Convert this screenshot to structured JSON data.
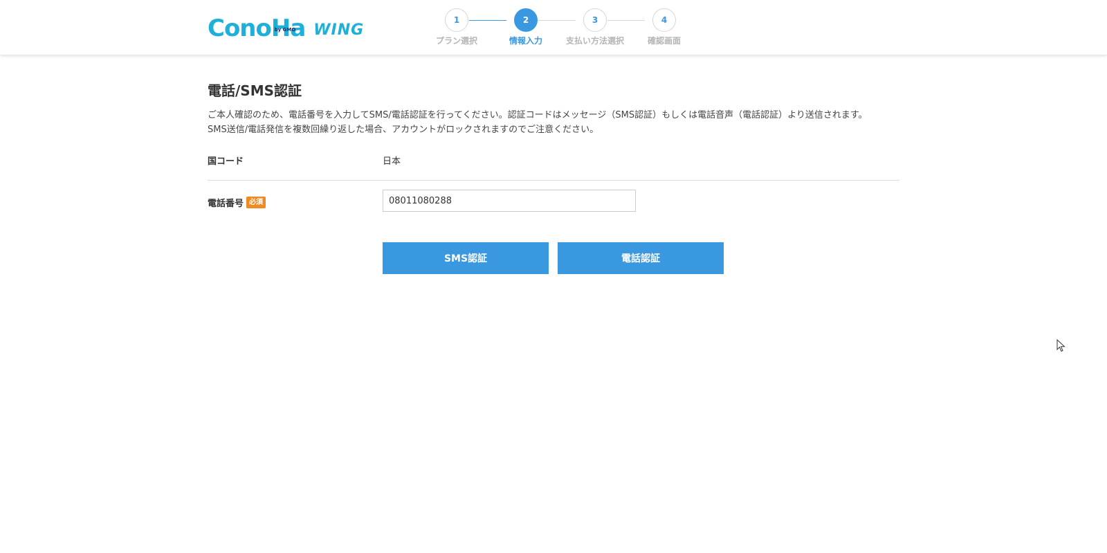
{
  "header": {
    "logo_text": "ConoHa",
    "logo_by": "by GMO",
    "logo_product": "WING",
    "steps": [
      {
        "number": "1",
        "label": "プラン選択",
        "active": false
      },
      {
        "number": "2",
        "label": "情報入力",
        "active": true
      },
      {
        "number": "3",
        "label": "支払い方法選択",
        "active": false
      },
      {
        "number": "4",
        "label": "確認画面",
        "active": false
      }
    ]
  },
  "main": {
    "title": "電話/SMS認証",
    "description_line1": "ご本人確認のため、電話番号を入力してSMS/電話認証を行ってください。認証コードはメッセージ（SMS認証）もしくは電話音声（電話認証）より送信されます。",
    "description_line2": "SMS送信/電話発信を複数回繰り返した場合、アカウントがロックされますのでご注意ください。",
    "country_label": "国コード",
    "country_value": "日本",
    "phone_label": "電話番号",
    "required_badge": "必須",
    "phone_value": "08011080288",
    "sms_button": "SMS認証",
    "call_button": "電話認証"
  },
  "colors": {
    "accent": "#3a98e0",
    "logo": "#1eb0d8",
    "required": "#f08a24"
  },
  "icons": {
    "cursor": "mouse-pointer-icon"
  }
}
